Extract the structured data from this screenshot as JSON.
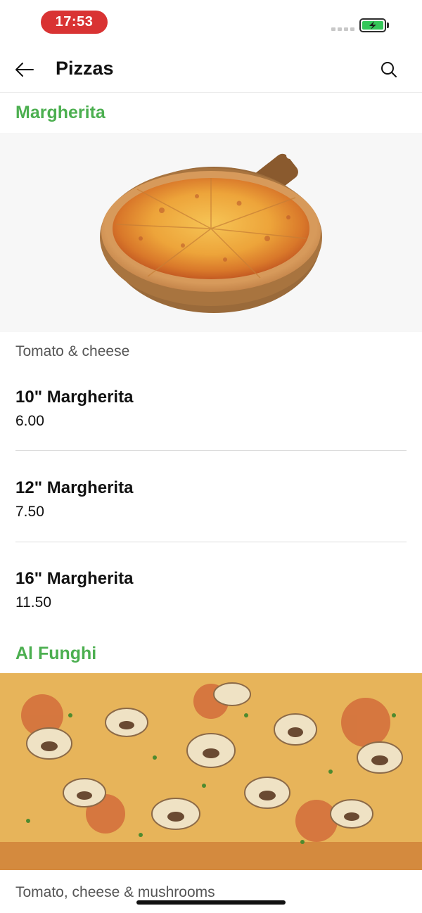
{
  "status_bar": {
    "time": "17:53"
  },
  "header": {
    "title": "Pizzas",
    "back_icon": "arrow-left-icon",
    "search_icon": "search-icon"
  },
  "categories": [
    {
      "title": "Margherita",
      "description": "Tomato & cheese",
      "items": [
        {
          "name": "10\" Margherita",
          "price": "6.00"
        },
        {
          "name": "12\" Margherita",
          "price": "7.50"
        },
        {
          "name": "16\" Margherita",
          "price": "11.50"
        }
      ]
    },
    {
      "title": "Al Funghi",
      "description": "Tomato, cheese & mushrooms"
    }
  ],
  "colors": {
    "accent_green": "#4caf50",
    "time_pill": "#d93333",
    "battery_green": "#34c759"
  }
}
